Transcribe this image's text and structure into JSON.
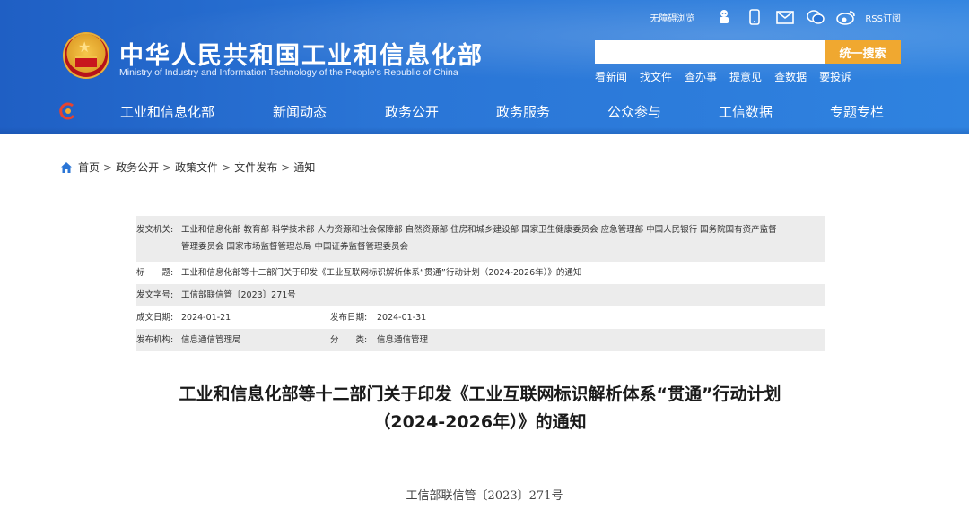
{
  "header": {
    "title": "中华人民共和国工业和信息化部",
    "subtitle": "Ministry of Industry and Information Technology of the People's Republic of China",
    "accessibility": "无障碍浏览",
    "rss": "RSS订阅",
    "icons": [
      "robot-icon",
      "mobile-icon",
      "mail-icon",
      "wechat-icon",
      "weibo-icon"
    ],
    "search_placeholder": "",
    "search_button": "统一搜索",
    "quick_links": [
      "看新闻",
      "找文件",
      "查办事",
      "提意见",
      "查数据",
      "要投诉"
    ],
    "colors": {
      "header_blue": "#2a75d6",
      "search_button": "#f0a830"
    }
  },
  "nav": {
    "items": [
      "工业和信息化部",
      "新闻动态",
      "政务公开",
      "政务服务",
      "公众参与",
      "工信数据",
      "专题专栏"
    ]
  },
  "breadcrumb": [
    "首页",
    "政务公开",
    "政策文件",
    "文件发布",
    "通知"
  ],
  "meta": {
    "issuer_label": "发文机关:",
    "issuer_line1": "工业和信息化部 教育部 科学技术部 人力资源和社会保障部 自然资源部 住房和城乡建设部 国家卫生健康委员会 应急管理部 中国人民银行 国务院国有资产监督",
    "issuer_line2": "管理委员会 国家市场监督管理总局 中国证券监督管理委员会",
    "title_label": "标　　题:",
    "title_value": "工业和信息化部等十二部门关于印发《工业互联网标识解析体系“贯通”行动计划（2024-2026年）》的通知",
    "docno_label": "发文字号:",
    "docno_value": "工信部联信管〔2023〕271号",
    "date_label": "成文日期:",
    "date_value": "2024-01-21",
    "pub_label": "发布日期:",
    "pub_value": "2024-01-31",
    "org_label": "发布机构:",
    "org_value": "信息通信管理局",
    "cat_label": "分　　类:",
    "cat_value": "信息通信管理"
  },
  "document": {
    "title_line1": "工业和信息化部等十二部门关于印发《工业互联网标识解析体系“贯通”行动计划",
    "title_line2": "（2024-2026年）》的通知",
    "number": "工信部联信管〔2023〕271号"
  }
}
